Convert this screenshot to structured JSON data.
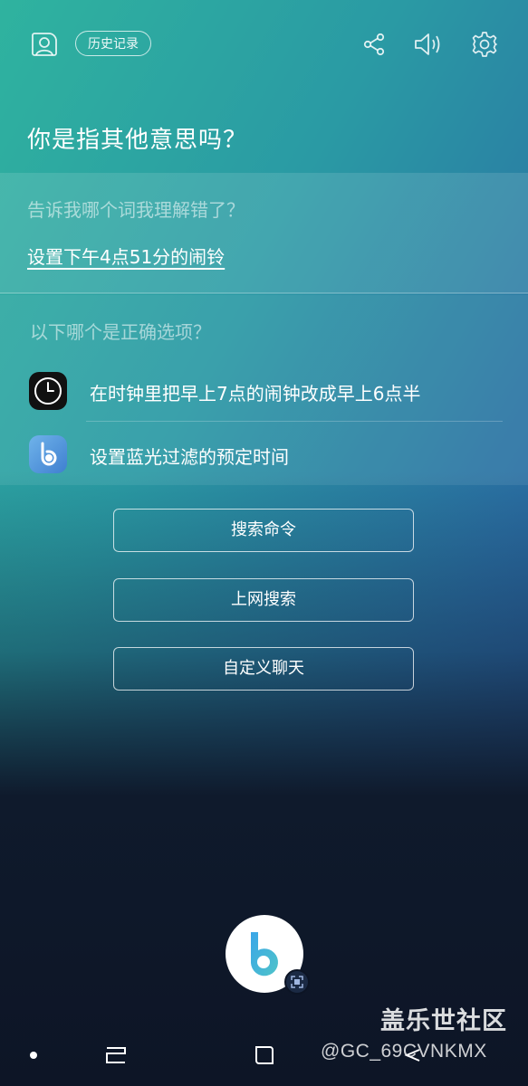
{
  "header": {
    "history_label": "历史记录",
    "icons": [
      "profile-icon",
      "share-icon",
      "volume-icon",
      "settings-icon"
    ]
  },
  "question": {
    "title": "你是指其他意思吗？",
    "misheard_prompt": "告诉我哪个词我理解错了？",
    "misheard_text": "设置下午4点51分的闹铃",
    "options_prompt": "以下哪个是正确选项？"
  },
  "options": [
    {
      "label": "在时钟里把早上7点的闹钟改成早上6点半",
      "icon": "clock-icon"
    },
    {
      "label": "设置蓝光过滤的预定时间",
      "icon": "bixby-app-icon"
    }
  ],
  "actions": [
    {
      "label": "搜索命令"
    },
    {
      "label": "上网搜索"
    },
    {
      "label": "自定义聊天"
    }
  ],
  "watermark": {
    "title": "盖乐世社区",
    "user": "@GC_69CVNKMX"
  },
  "colors": {
    "accent_teal": "#2fb39f",
    "accent_blue": "#2a4f99",
    "bottom_dark": "#0d1526",
    "bixby_blue": "#3f8fd6"
  }
}
